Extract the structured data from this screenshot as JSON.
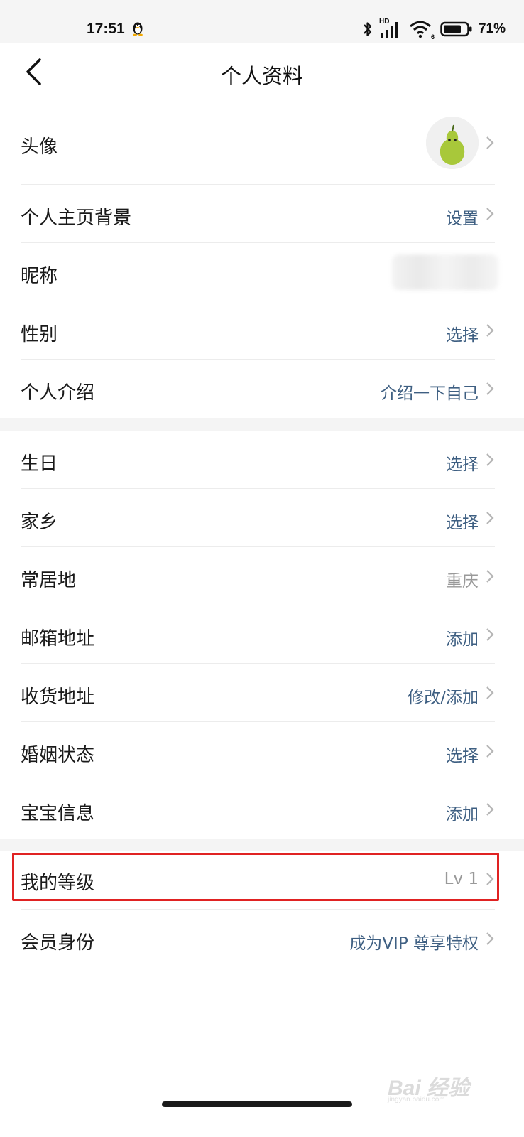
{
  "status_bar": {
    "time": "17:51",
    "network": "HD",
    "wifi_badge": "6",
    "battery": "71%"
  },
  "header": {
    "title": "个人资料"
  },
  "section1": [
    {
      "label": "头像",
      "type": "avatar"
    },
    {
      "label": "个人主页背景",
      "value": "设置"
    },
    {
      "label": "昵称",
      "value": ""
    },
    {
      "label": "性别",
      "value": "选择"
    },
    {
      "label": "个人介绍",
      "value": "介绍一下自己"
    }
  ],
  "section2": [
    {
      "label": "生日",
      "value": "选择"
    },
    {
      "label": "家乡",
      "value": "选择"
    },
    {
      "label": "常居地",
      "value": "重庆"
    },
    {
      "label": "邮箱地址",
      "value": "添加"
    },
    {
      "label": "收货地址",
      "value": "修改/添加"
    },
    {
      "label": "婚姻状态",
      "value": "选择"
    },
    {
      "label": "宝宝信息",
      "value": "添加"
    }
  ],
  "section3": [
    {
      "label": "我的等级",
      "value": "Lv 1"
    },
    {
      "label": "会员身份",
      "value": "成为VIP 尊享特权"
    }
  ],
  "watermark": {
    "text": "Bai 经验",
    "sub": "jingyan.baidu.com"
  },
  "colors": {
    "link_value": "#3e5f82",
    "muted_value": "#999999",
    "highlight": "#e02222",
    "avatar_pear": "#a8c83a"
  }
}
